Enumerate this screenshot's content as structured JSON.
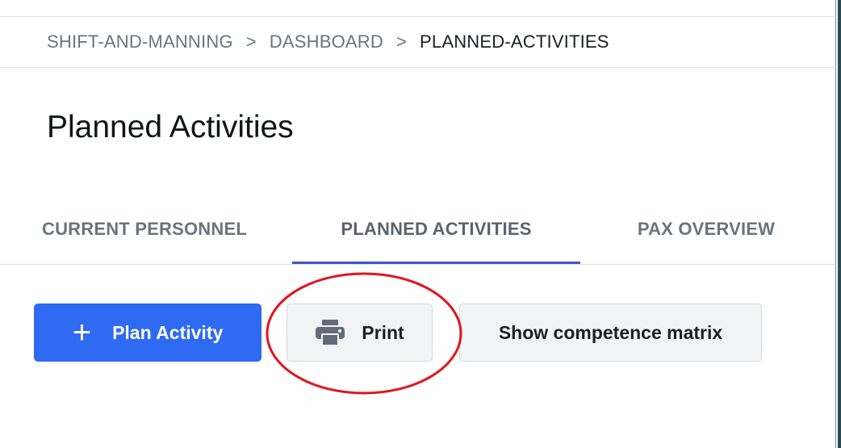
{
  "breadcrumb": {
    "items": [
      "SHIFT-AND-MANNING",
      "DASHBOARD",
      "PLANNED-ACTIVITIES"
    ],
    "separator": ">"
  },
  "page": {
    "title": "Planned Activities"
  },
  "tabs": [
    {
      "label": "CURRENT PERSONNEL",
      "active": false
    },
    {
      "label": "PLANNED ACTIVITIES",
      "active": true
    },
    {
      "label": "PAX OVERVIEW",
      "active": false
    }
  ],
  "toolbar": {
    "plan_activity_label": "Plan Activity",
    "plan_activity_icon": "plus-icon",
    "print_label": "Print",
    "print_icon": "printer-icon",
    "competence_matrix_label": "Show competence matrix"
  },
  "colors": {
    "primary": "#2f6af2",
    "tab_indicator": "#4355c9",
    "annotation": "#e0151e"
  }
}
